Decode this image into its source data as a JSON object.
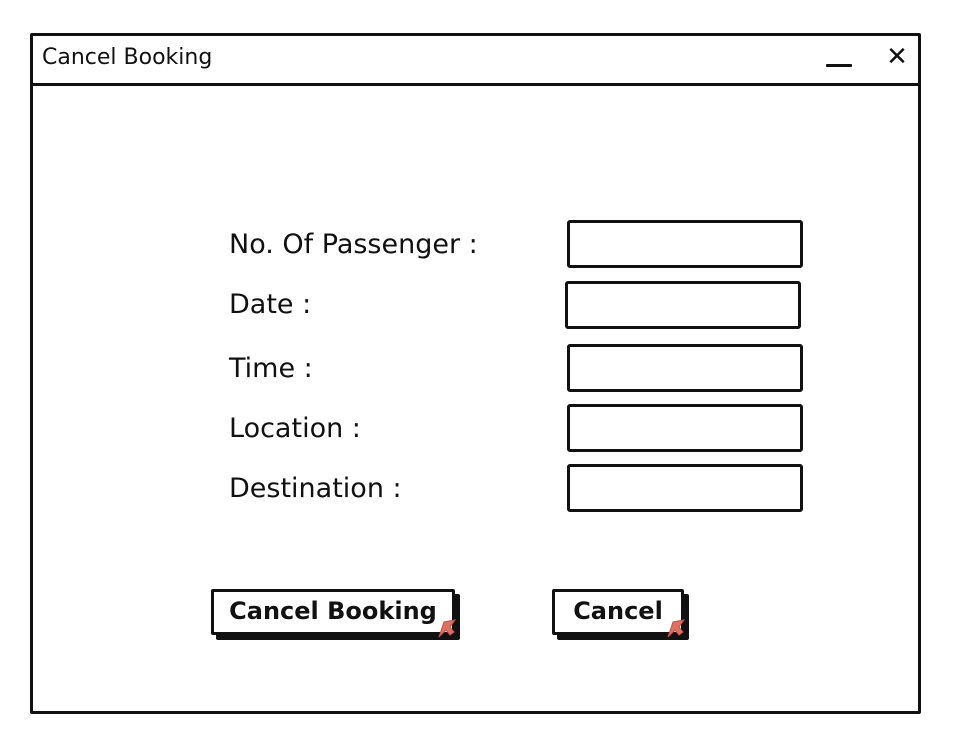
{
  "window": {
    "title": "Cancel Booking",
    "minimize_icon": "minimize-icon",
    "close_icon": "close-icon",
    "close_glyph": "✕"
  },
  "form": {
    "fields": [
      {
        "label": "No. Of Passenger :",
        "value": ""
      },
      {
        "label": "Date :",
        "value": ""
      },
      {
        "label": "Time :",
        "value": ""
      },
      {
        "label": "Location :",
        "value": ""
      },
      {
        "label": "Destination :",
        "value": ""
      }
    ]
  },
  "actions": {
    "primary_label": "Cancel Booking",
    "secondary_label": "Cancel",
    "cursor_icon": "pointer-cursor-icon",
    "cursor_color": "#e07060"
  }
}
